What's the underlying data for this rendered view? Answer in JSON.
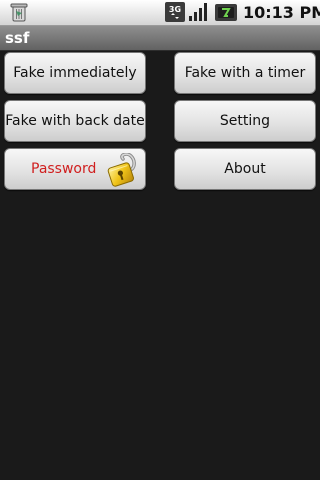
{
  "status_bar": {
    "time": "10:13 PM",
    "network_label": "3G",
    "icons": [
      "trash-icon",
      "3g-icon",
      "signal-icon",
      "battery-icon"
    ]
  },
  "app": {
    "title": "ssf"
  },
  "buttons": {
    "fake_immediately": "Fake immediately",
    "fake_with_timer": "Fake with a timer",
    "fake_with_back_date": "Fake with back date",
    "setting": "Setting",
    "password": "Password",
    "about": "About"
  },
  "colors": {
    "background": "#1a1a1a",
    "password_text": "#d01f1f",
    "title_bar": "#7a7a7a"
  }
}
